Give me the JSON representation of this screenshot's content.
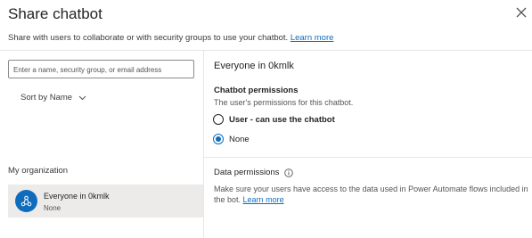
{
  "dialog": {
    "title": "Share chatbot",
    "subtitle": "Share with users to collaborate or with security groups to use your chatbot.",
    "subtitle_link": "Learn more"
  },
  "left": {
    "search_placeholder": "Enter a name, security group, or email address",
    "sort_label": "Sort by Name",
    "org_heading": "My organization",
    "org_item": {
      "name": "Everyone in 0kmlk",
      "role": "None",
      "avatar_icon": "org-tree-icon",
      "avatar_color": "#0f6cbd"
    }
  },
  "right": {
    "title": "Everyone in 0kmlk",
    "permissions_heading": "Chatbot permissions",
    "permissions_desc": "The user's permissions for this chatbot.",
    "options": [
      {
        "label": "User - can use the chatbot",
        "selected": false
      },
      {
        "label": "None",
        "selected": true
      }
    ],
    "data_heading": "Data permissions",
    "data_desc": "Make sure your users have access to the data used in Power Automate flows included in the bot.",
    "data_link": "Learn more"
  },
  "colors": {
    "accent": "#0f6cbd",
    "selected_row": "#ecebea"
  }
}
